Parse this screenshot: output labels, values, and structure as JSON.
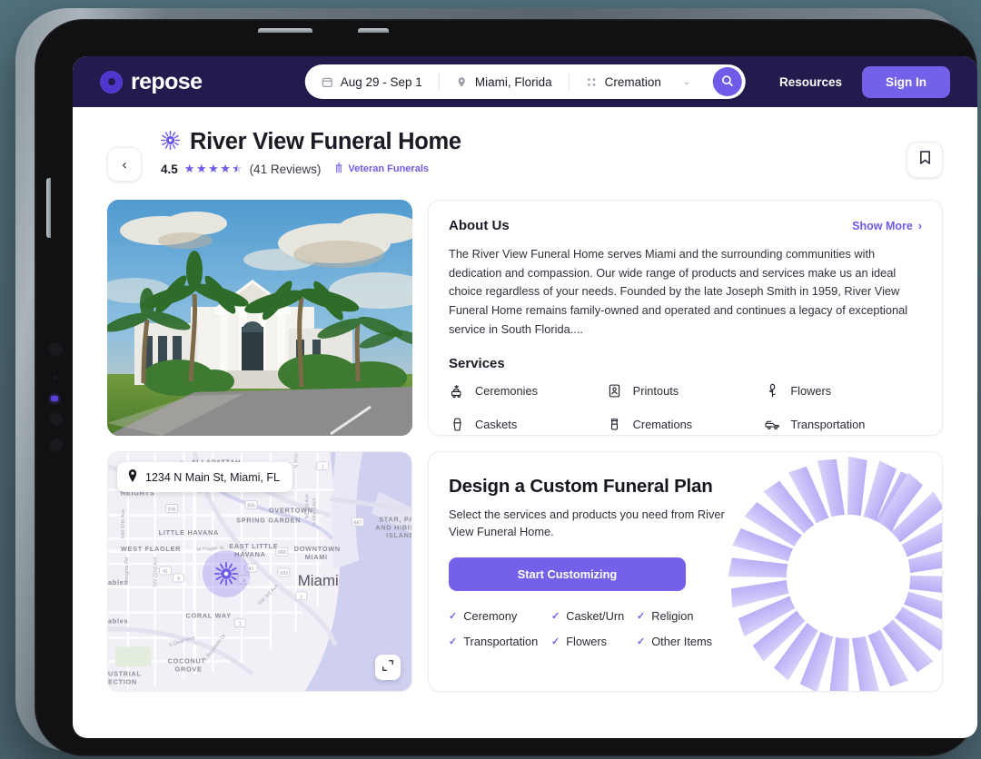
{
  "brand": {
    "name": "repose",
    "accent": "#6d5ce7",
    "navy": "#231b4d"
  },
  "search": {
    "date": "Aug 29 - Sep 1",
    "location": "Miami, Florida",
    "service_type": "Cremation",
    "search_icon": "search-icon",
    "calendar_icon": "calendar-icon",
    "pin_icon": "map-pin-icon",
    "grid_icon": "grid-icon",
    "chevron": "⌄"
  },
  "nav": {
    "resources": "Resources",
    "signin": "Sign In"
  },
  "listing": {
    "back": "‹",
    "name": "River View Funeral Home",
    "rating": "4.5",
    "reviews": "(41 Reviews)",
    "badge": "Veteran Funerals",
    "bookmark_icon": "bookmark-icon"
  },
  "about": {
    "title": "About Us",
    "show_more": "Show More",
    "body": "The River View Funeral Home serves Miami and the surrounding communities with dedication and compassion. Our wide range of products and services make us an ideal choice regardless of your needs. Founded by the late Joseph Smith in 1959, River View Funeral Home remains family-owned and operated and continues a legacy of exceptional service in South Florida...."
  },
  "services": {
    "title": "Services",
    "items": [
      {
        "label": "Ceremonies",
        "icon": "ceremonies-icon"
      },
      {
        "label": "Printouts",
        "icon": "printouts-icon"
      },
      {
        "label": "Flowers",
        "icon": "flowers-icon"
      },
      {
        "label": "Caskets",
        "icon": "casket-icon"
      },
      {
        "label": "Cremations",
        "icon": "urn-icon"
      },
      {
        "label": "Transportation",
        "icon": "hearse-icon"
      }
    ]
  },
  "map": {
    "address": "1234 N Main St, Miami, FL",
    "expand_icon": "expand-icon",
    "labels": [
      "ALLAPATTAH",
      "HEIGHTS",
      "OVERTOWN",
      "SPRING GARDEN",
      "LITTLE HAVANA",
      "WEST FLAGLER",
      "EAST LITTLE",
      "HAVANA",
      "DOWNTOWN",
      "MIAMI",
      "STAR, PA",
      "AND HIBIS",
      "ISLAND",
      "CORAL WAY",
      "COCONUT",
      "GROVE",
      "USTRIAL",
      "ECTION",
      "ables",
      "Miami",
      "W Flagler St"
    ]
  },
  "plan": {
    "title": "Design a Custom Funeral Plan",
    "subtitle": "Select the services and products you need from River View Funeral Home.",
    "cta": "Start Customizing",
    "features": [
      "Ceremony",
      "Casket/Urn",
      "Religion",
      "Transportation",
      "Flowers",
      "Other Items"
    ]
  }
}
